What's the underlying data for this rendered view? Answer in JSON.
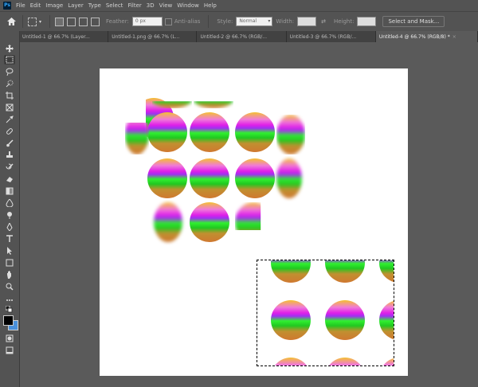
{
  "app": {
    "logo": "Ps"
  },
  "menu": [
    "File",
    "Edit",
    "Image",
    "Layer",
    "Type",
    "Select",
    "Filter",
    "3D",
    "View",
    "Window",
    "Help"
  ],
  "options": {
    "feather_label": "Feather:",
    "feather_value": "0 px",
    "anti_alias_label": "Anti-alias",
    "style_label": "Style:",
    "style_value": "Normal",
    "width_label": "Width:",
    "height_label": "Height:",
    "select_mask_button": "Select and Mask..."
  },
  "tabs": [
    {
      "label": "Untitled-1 @ 66.7% (Layer...",
      "active": false
    },
    {
      "label": "Untitled-1.png @ 66.7% (L...",
      "active": false
    },
    {
      "label": "Untitled-2 @ 66.7% (RGB/...",
      "active": false
    },
    {
      "label": "Untitled-3 @ 66.7% (RGB/...",
      "active": false
    },
    {
      "label": "Untitled-4 @ 66.7% (RGB/8) *",
      "active": true
    }
  ],
  "tools": [
    "move-tool",
    "marquee-tool",
    "lasso-tool",
    "quick-select-tool",
    "crop-tool",
    "frame-tool",
    "eyedropper-tool",
    "healing-tool",
    "brush-tool",
    "clone-stamp-tool",
    "history-brush-tool",
    "eraser-tool",
    "gradient-tool",
    "blur-tool",
    "dodge-tool",
    "pen-tool",
    "type-tool",
    "path-select-tool",
    "rectangle-tool",
    "hand-tool",
    "zoom-tool",
    "more-tools",
    "default-colors",
    "quick-mask",
    "screen-mode"
  ],
  "colors": {
    "foreground": "#000000",
    "background": "#4a90d9"
  }
}
